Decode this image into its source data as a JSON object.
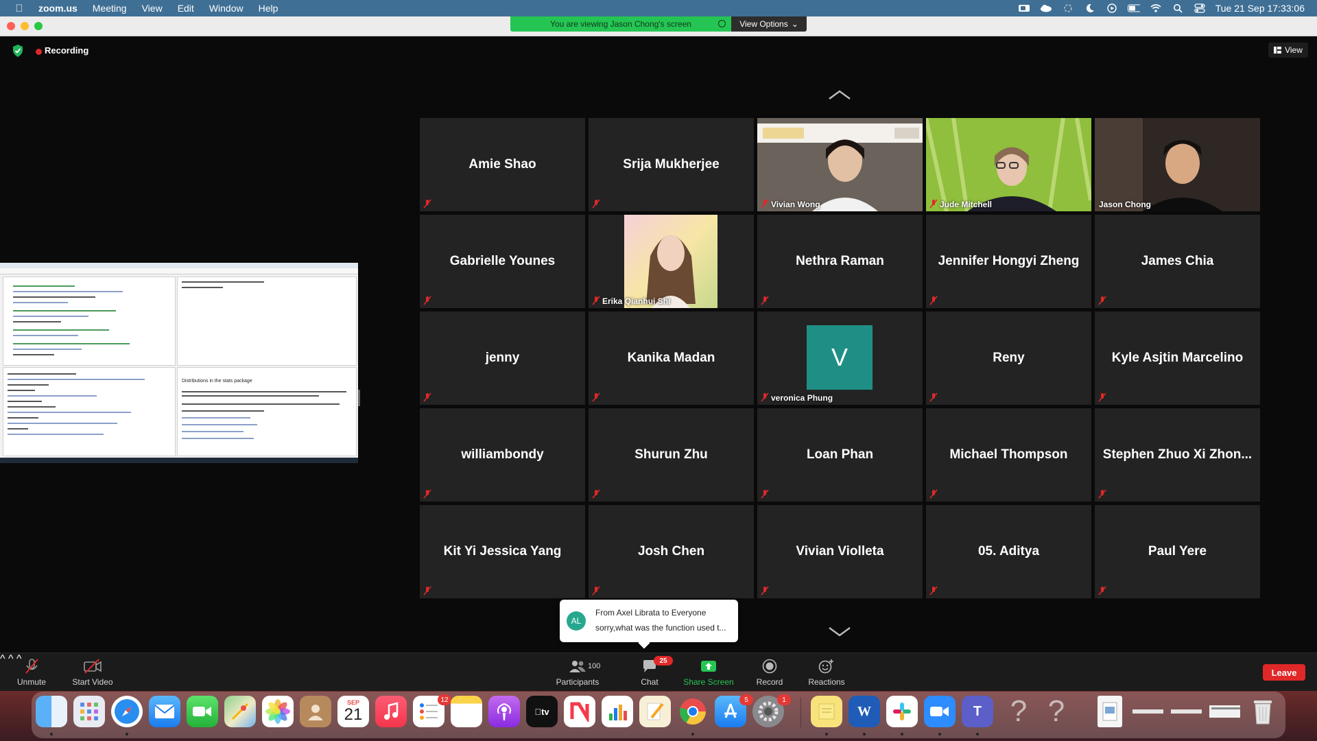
{
  "menubar": {
    "app_name": "zoom.us",
    "items": [
      "Meeting",
      "View",
      "Edit",
      "Window",
      "Help"
    ],
    "datetime": "Tue 21 Sep  17:33:06"
  },
  "banner": {
    "viewing_text": "You are viewing Jason Chong's screen",
    "view_options": "View Options"
  },
  "meeting": {
    "recording_label": "Recording",
    "view_button": "View"
  },
  "shared_screen": {
    "help_title": "Distributions in the stats package"
  },
  "participants": [
    {
      "name": "Amie Shao",
      "video": false
    },
    {
      "name": "Srija Mukherjee",
      "video": false
    },
    {
      "name": "Vivian Wong",
      "video": true
    },
    {
      "name": "Jude Mitchell",
      "video": true
    },
    {
      "name": "Jason Chong",
      "video": true,
      "active_speaker": true
    },
    {
      "name": "Gabrielle Younes",
      "video": false
    },
    {
      "name": "Erika Qianhui Shi",
      "video": true
    },
    {
      "name": "Nethra Raman",
      "video": false
    },
    {
      "name": "Jennifer Hongyi Zheng",
      "video": false
    },
    {
      "name": "James Chia",
      "video": false
    },
    {
      "name": "jenny",
      "video": false
    },
    {
      "name": "Kanika Madan",
      "video": false
    },
    {
      "name": "veronica Phung",
      "video": false,
      "avatar_letter": "V"
    },
    {
      "name": "Reny",
      "video": false
    },
    {
      "name": "Kyle Asjtin Marcelino",
      "video": false
    },
    {
      "name": "williambondy",
      "video": false
    },
    {
      "name": "Shurun Zhu",
      "video": false
    },
    {
      "name": "Loan Phan",
      "video": false
    },
    {
      "name": "Michael Thompson",
      "video": false
    },
    {
      "name": "Stephen Zhuo Xi Zhon...",
      "video": false
    },
    {
      "name": "Kit Yi Jessica Yang",
      "video": false
    },
    {
      "name": "Josh Chen",
      "video": false
    },
    {
      "name": "Vivian Violleta",
      "video": false
    },
    {
      "name": "05. Aditya",
      "video": false
    },
    {
      "name": "Paul Yere",
      "video": false
    }
  ],
  "chat_toast": {
    "initials": "AL",
    "from": "From Axel Librata to Everyone",
    "message": "sorry,what was the function used t..."
  },
  "controls": {
    "unmute": "Unmute",
    "start_video": "Start Video",
    "participants": "Participants",
    "participants_count": "100",
    "chat": "Chat",
    "chat_badge": "25",
    "share_screen": "Share Screen",
    "record": "Record",
    "reactions": "Reactions",
    "leave": "Leave"
  },
  "dock": {
    "calendar_month": "SEP",
    "calendar_day": "21",
    "reminders_badge": "12",
    "appstore_badge": "5",
    "settings_badge": "1",
    "icons": [
      "finder-icon",
      "launchpad-icon",
      "safari-icon",
      "mail-icon",
      "facetime-icon",
      "maps-icon",
      "photos-icon",
      "contacts-icon",
      "calendar-icon",
      "music-icon",
      "reminders-icon",
      "notes-icon",
      "podcasts-icon",
      "appletv-icon",
      "news-icon",
      "numbers-icon",
      "pages-icon",
      "chrome-icon",
      "appstore-icon",
      "system-preferences-icon",
      "stickies-icon",
      "word-icon",
      "slack-icon",
      "zoom-icon",
      "teams-icon",
      "unknown-app-icon",
      "unknown-app-icon-2",
      "preview-file-icon",
      "window-thumb-icon",
      "window-thumb-icon-2",
      "window-thumb-icon-3",
      "trash-icon"
    ]
  },
  "colors": {
    "menubar": "#3f6f95",
    "banner_green": "#25c553",
    "active_speaker_outline": "#e6e35a",
    "leave_red": "#e02828",
    "share_green": "#25c553"
  }
}
